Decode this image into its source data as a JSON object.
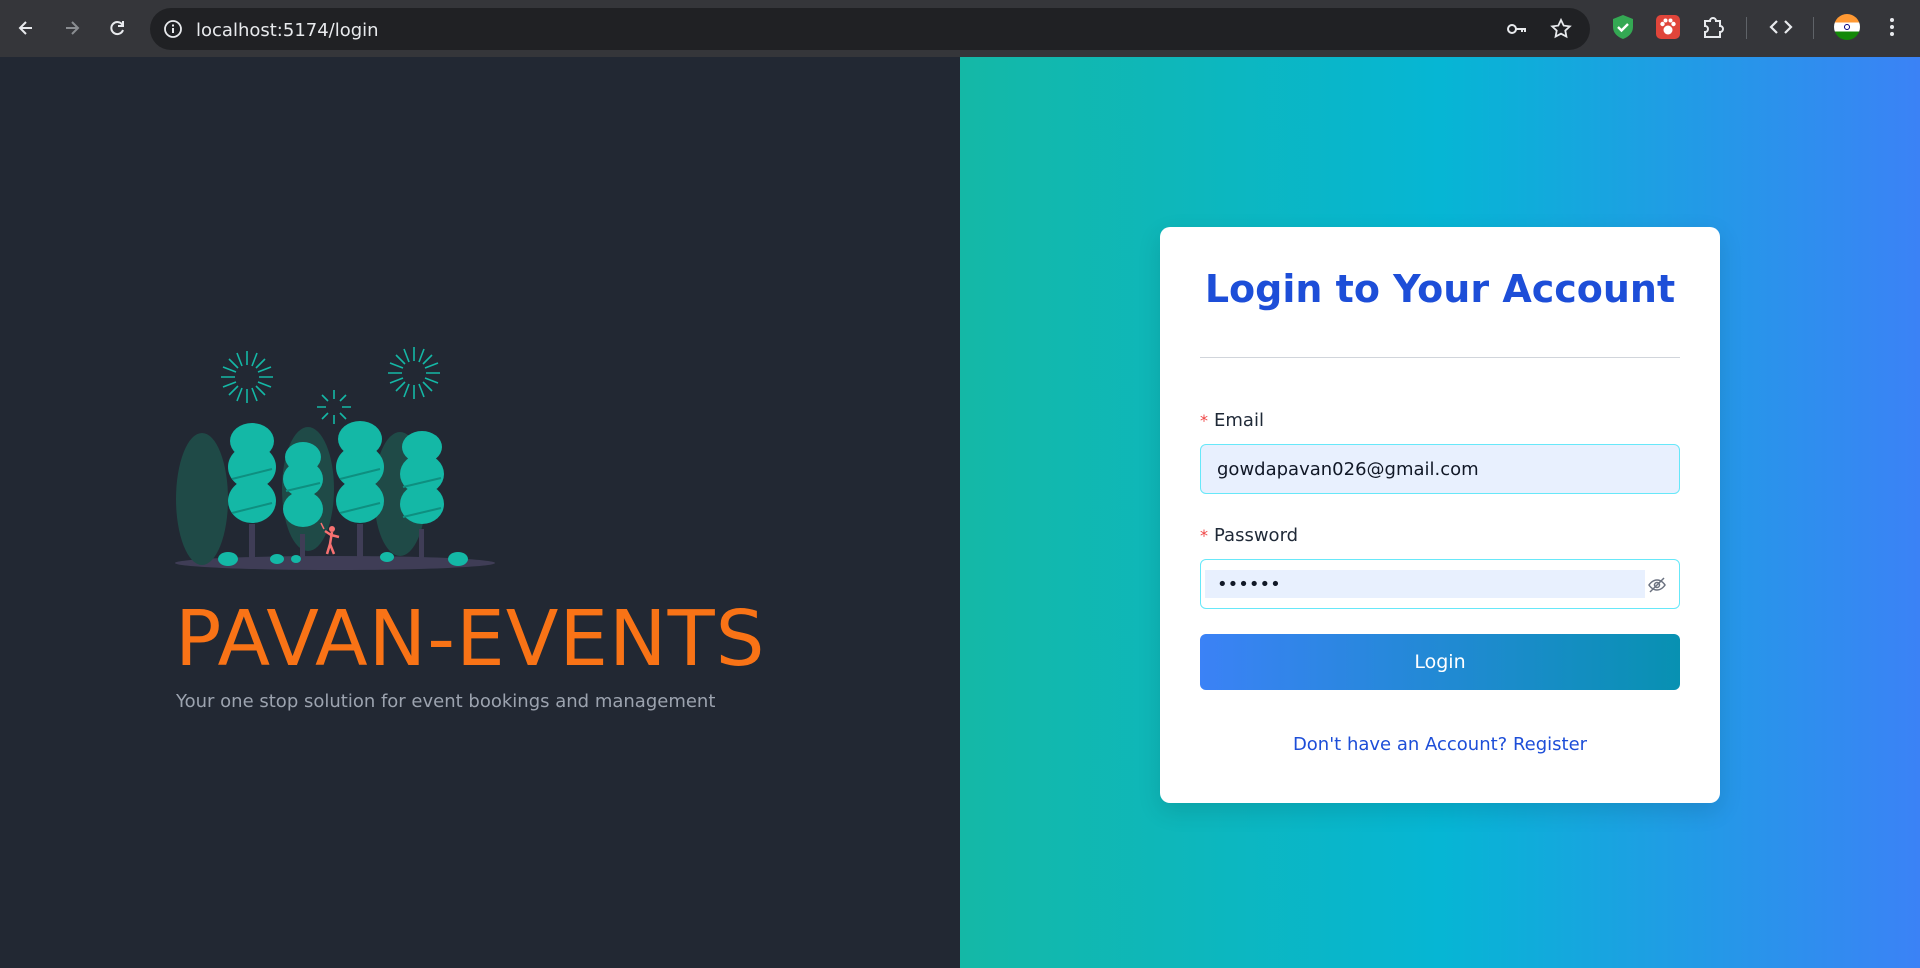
{
  "browser": {
    "url": "localhost:5174/login"
  },
  "brand": {
    "name": "PAVAN-EVENTS",
    "tagline": "Your one stop solution for event bookings and management",
    "title_color": "#f97316"
  },
  "login_form": {
    "title": "Login to Your Account",
    "email_label": "Email",
    "email_value": "gowdapavan026@gmail.com",
    "password_label": "Password",
    "password_value": "••••••",
    "required_mark": "*",
    "submit_label": "Login",
    "register_link": "Don't have an Account? Register"
  },
  "colors": {
    "accent_blue": "#1d4ed8",
    "left_panel_bg": "#222833",
    "gradient": [
      "#14b8a6",
      "#06b6d4",
      "#3b82f6"
    ]
  },
  "icons": [
    "back-arrow-icon",
    "forward-arrow-icon",
    "reload-icon",
    "site-info-icon",
    "password-key-icon",
    "bookmark-star-icon",
    "shield-extension-icon",
    "paw-extension-icon",
    "puzzle-extensions-icon",
    "devtools-code-icon",
    "profile-flag-icon",
    "menu-kebab-icon",
    "eye-slash-icon"
  ]
}
